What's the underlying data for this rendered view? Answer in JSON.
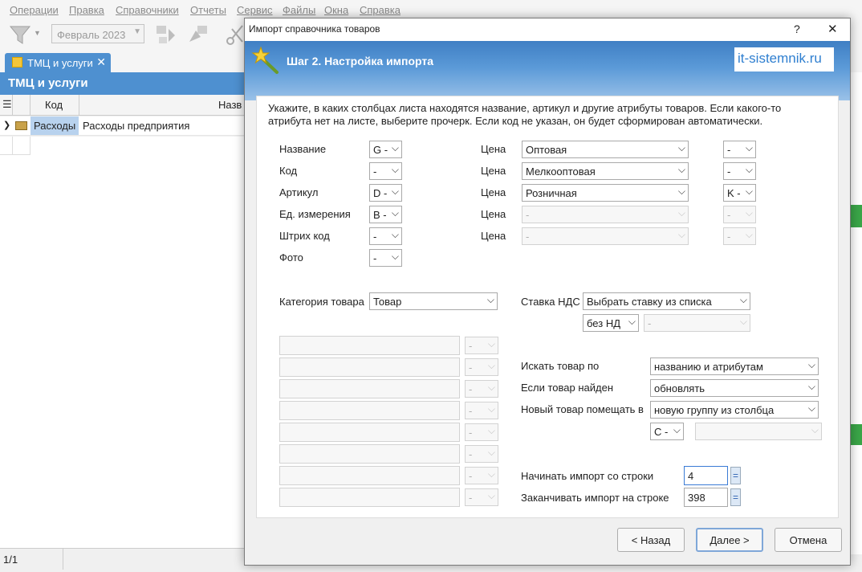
{
  "app": {
    "menu": [
      "Операции",
      "Правка",
      "Справочники",
      "Отчеты",
      "Сервис",
      "Файлы",
      "Окна",
      "Справка"
    ],
    "period": "Февраль 2023",
    "tab_label": "ТМЦ и услуги",
    "header_title": "ТМЦ и услуги",
    "grid": {
      "col_code": "Код",
      "col_name": "Назв",
      "row_code": "Расходы",
      "row_name": "Расходы предприятия"
    },
    "status": "1/1"
  },
  "dialog": {
    "title": "Импорт справочника товаров",
    "help": "?",
    "close": "✕",
    "step_title": "Шаг 2. Настройка импорта",
    "watermark": "it-sistemnik.ru",
    "instructions": "Укажите, в каких столбцах листа находятся название, артикул и другие атрибуты товаров. Если какого-то атрибута нет на листе, выберите прочерк. Если код не указан, он будет сформирован автоматически.",
    "fields": [
      {
        "label": "Название",
        "value": "G -"
      },
      {
        "label": "Код",
        "value": "-"
      },
      {
        "label": "Артикул",
        "value": "D -"
      },
      {
        "label": "Ед. измерения",
        "value": "B -"
      },
      {
        "label": "Штрих код",
        "value": "-"
      },
      {
        "label": "Фото",
        "value": "-"
      }
    ],
    "prices": [
      {
        "label": "Цена",
        "type": "Оптовая",
        "col": "-"
      },
      {
        "label": "Цена",
        "type": "Мелкооптовая",
        "col": "-"
      },
      {
        "label": "Цена",
        "type": "Розничная",
        "col": "K -"
      },
      {
        "label": "Цена",
        "type": "-",
        "col": "-"
      },
      {
        "label": "Цена",
        "type": "-",
        "col": "-"
      }
    ],
    "category_label": "Категория товара",
    "category_value": "Товар",
    "vat_label": "Ставка НДС",
    "vat_value": "Выбрать ставку из списка",
    "vat_rate": "без НД",
    "vat_col": "-",
    "dash": "-",
    "search_label": "Искать товар по",
    "search_value": "названию и атрибутам",
    "found_label": "Если товар найден",
    "found_value": "обновлять",
    "new_label": "Новый товар помещать в",
    "new_value": "новую группу из столбца",
    "group_col": "C -",
    "start_label": "Начинать импорт со строки",
    "start_value": "4",
    "end_label": "Заканчивать импорт на строке",
    "end_value": "398",
    "eq": "=",
    "buttons": {
      "back": "< Назад",
      "next": "Далее >",
      "cancel": "Отмена"
    }
  },
  "colors": {
    "accent": "#4e90d0",
    "banner": "#5b9ad8"
  }
}
